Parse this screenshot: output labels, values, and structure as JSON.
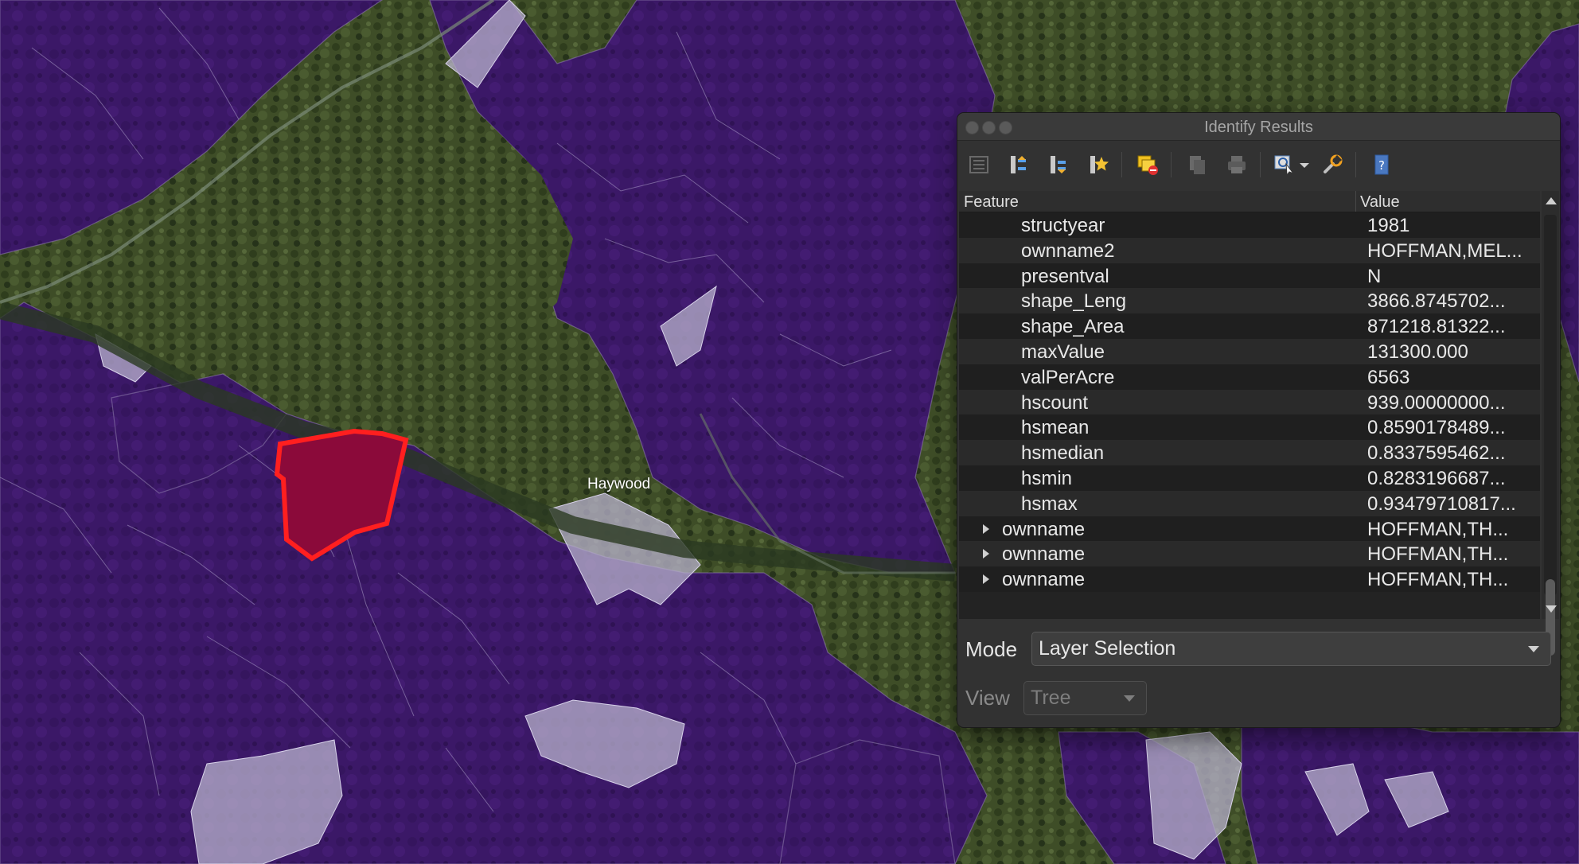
{
  "map": {
    "place_label": "Haywood",
    "colors": {
      "parcel_fill": "#3d1a6a",
      "selected_parcel_fill": "#8b0a3a",
      "selected_parcel_stroke": "#ff1f1f",
      "light_parcel": "#b8b2cc",
      "forest": "#3a4a26"
    }
  },
  "window": {
    "title": "Identify Results",
    "toolbar_icons": [
      "expand-tree-icon",
      "expand-all-icon",
      "collapse-all-icon",
      "expand-new-results-icon",
      "clear-results-icon",
      "copy-icon",
      "print-icon",
      "identify-features-icon",
      "identify-dropdown-icon",
      "settings-wrench-icon",
      "help-icon"
    ],
    "table": {
      "columns": [
        "Feature",
        "Value"
      ],
      "rows": [
        {
          "feature": "structyear",
          "value": "1981"
        },
        {
          "feature": "ownname2",
          "value": "HOFFMAN,MEL..."
        },
        {
          "feature": "presentval",
          "value": "N"
        },
        {
          "feature": "shape_Leng",
          "value": "3866.8745702..."
        },
        {
          "feature": "shape_Area",
          "value": "871218.81322..."
        },
        {
          "feature": "maxValue",
          "value": "131300.000"
        },
        {
          "feature": "valPerAcre",
          "value": "6563"
        },
        {
          "feature": "hscount",
          "value": "939.00000000..."
        },
        {
          "feature": "hsmean",
          "value": "0.8590178489..."
        },
        {
          "feature": "hsmedian",
          "value": "0.8337595462..."
        },
        {
          "feature": "hsmin",
          "value": "0.8283196687..."
        },
        {
          "feature": "hsmax",
          "value": "0.93479710817..."
        },
        {
          "feature": "ownname",
          "value": "HOFFMAN,TH..."
        },
        {
          "feature": "ownname",
          "value": "HOFFMAN,TH..."
        },
        {
          "feature": "ownname",
          "value": "HOFFMAN,TH..."
        }
      ]
    },
    "mode": {
      "label": "Mode",
      "value": "Layer Selection"
    },
    "view": {
      "label": "View",
      "value": "Tree"
    }
  }
}
